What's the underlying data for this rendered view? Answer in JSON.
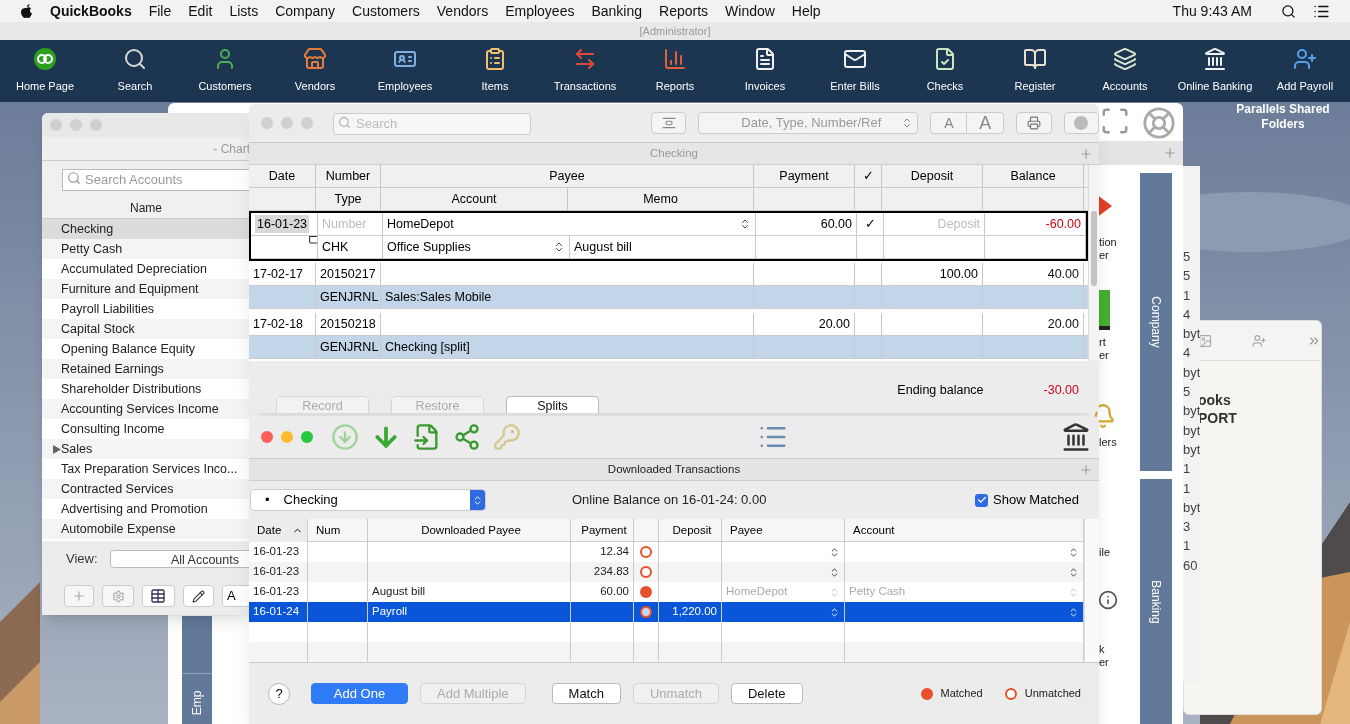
{
  "menu_bar": {
    "app": "QuickBooks",
    "items": [
      "File",
      "Edit",
      "Lists",
      "Company",
      "Customers",
      "Vendors",
      "Employees",
      "Banking",
      "Reports",
      "Window",
      "Help"
    ],
    "clock": "Thu 9:43 AM"
  },
  "title_strip": "[Administrator]",
  "toolbar": [
    {
      "label": "Home Page"
    },
    {
      "label": "Search"
    },
    {
      "label": "Customers"
    },
    {
      "label": "Vendors"
    },
    {
      "label": "Employees"
    },
    {
      "label": "Items"
    },
    {
      "label": "Transactions"
    },
    {
      "label": "Reports"
    },
    {
      "label": "Invoices"
    },
    {
      "label": "Enter Bills"
    },
    {
      "label": "Checks"
    },
    {
      "label": "Register"
    },
    {
      "label": "Accounts"
    },
    {
      "label": "Online Banking"
    },
    {
      "label": "Add Payroll"
    }
  ],
  "desktop": {
    "folder_label": "Parallels Shared Folders"
  },
  "home_page": {
    "side_tabs": [
      "Company",
      "Banking"
    ],
    "left_tab": "Emp",
    "icon_labels": [
      {
        "lines": [
          "tion",
          "er"
        ]
      },
      {
        "lines": [
          "rt",
          "er"
        ]
      },
      {
        "lines": [
          "lers"
        ]
      },
      {
        "lines": [
          "ile"
        ]
      },
      {
        "lines": [
          "k",
          "er"
        ]
      }
    ]
  },
  "side_list": {
    "entries": [
      "5",
      "5",
      "1",
      "4",
      "byt",
      "4",
      "byt",
      "5",
      "byt",
      "byt",
      "byt",
      "1",
      "1",
      "byt",
      "3",
      "1",
      "60"
    ]
  },
  "notes": {
    "lines": [
      "ooks",
      "PORT"
    ]
  },
  "chart_of_accounts": {
    "title": "- Chart",
    "search_placeholder": "Search Accounts",
    "column": "Name",
    "accounts": [
      {
        "name": "Checking",
        "selected": true,
        "expandable": false
      },
      {
        "name": "Petty Cash",
        "selected": false,
        "expandable": false
      },
      {
        "name": "Accumulated Depreciation",
        "selected": false,
        "expandable": false
      },
      {
        "name": "Furniture and Equipment",
        "selected": false,
        "expandable": false
      },
      {
        "name": "Payroll Liabilities",
        "selected": false,
        "expandable": false
      },
      {
        "name": "Capital Stock",
        "selected": false,
        "expandable": false
      },
      {
        "name": "Opening Balance Equity",
        "selected": false,
        "expandable": false
      },
      {
        "name": "Retained Earnings",
        "selected": false,
        "expandable": false
      },
      {
        "name": "Shareholder Distributions",
        "selected": false,
        "expandable": false
      },
      {
        "name": "Accounting Services Income",
        "selected": false,
        "expandable": false
      },
      {
        "name": "Consulting Income",
        "selected": false,
        "expandable": false
      },
      {
        "name": "Sales",
        "selected": false,
        "expandable": true
      },
      {
        "name": "Tax Preparation Services Inco...",
        "selected": false,
        "expandable": false
      },
      {
        "name": "Contracted Services",
        "selected": false,
        "expandable": false
      },
      {
        "name": "Advertising and Promotion",
        "selected": false,
        "expandable": false
      },
      {
        "name": "Automobile Expense",
        "selected": false,
        "expandable": false
      }
    ],
    "view_label": "View:",
    "view_value": "All Accounts",
    "cut_button": "A"
  },
  "register": {
    "search_placeholder": "Search",
    "sort_value": "Date, Type, Number/Ref",
    "font_buttons": [
      "A",
      "A"
    ],
    "title": "Checking",
    "header_top": [
      "Date",
      "Number",
      "Payee",
      "Payment",
      "✓",
      "Deposit",
      "Balance"
    ],
    "header_bottom": [
      "Type",
      "Account",
      "Memo"
    ],
    "transactions": [
      {
        "editing": true,
        "date": "16-01-23",
        "number_placeholder": "Number",
        "payee": "HomeDepot",
        "payment": "60.00",
        "cleared": "✓",
        "deposit_placeholder": "Deposit",
        "balance": "-60.00",
        "negative": true,
        "type": "CHK",
        "account": "Office Supplies",
        "memo": "August bill"
      },
      {
        "editing": false,
        "date": "17-02-17",
        "number": "20150217",
        "deposit": "100.00",
        "balance": "40.00",
        "negative": false,
        "type": "GENJRNL",
        "account": "Sales:Sales Mobile"
      },
      {
        "editing": false,
        "date": "17-02-18",
        "number": "20150218",
        "payment": "20.00",
        "balance": "20.00",
        "negative": false,
        "type": "GENJRNL",
        "account": "Checking [split]"
      }
    ],
    "ending_label": "Ending balance",
    "ending_value": "-30.00",
    "ending_negative": true,
    "buttons": [
      {
        "label": "Record",
        "disabled": true
      },
      {
        "label": "Restore",
        "disabled": true
      },
      {
        "label": "Splits",
        "disabled": false
      }
    ]
  },
  "downloaded": {
    "title": "Downloaded Transactions",
    "account_bullet": "•",
    "account": "Checking",
    "online_balance": "Online Balance on 16-01-24: 0.00",
    "show_matched": {
      "label": "Show Matched",
      "checked": true
    },
    "columns": [
      {
        "label": "Date",
        "sorted": true
      },
      {
        "label": "Num",
        "sorted": false
      },
      {
        "label": "Downloaded Payee",
        "sorted": false
      },
      {
        "label": "Payment",
        "sorted": false
      },
      {
        "sorted": false
      },
      {
        "label": "Deposit",
        "sorted": false
      },
      {
        "label": "Payee",
        "sorted": false
      },
      {
        "label": "Account",
        "sorted": false
      }
    ],
    "rows": [
      {
        "date": "16-01-23",
        "payment": "12.34",
        "matched": false,
        "selected": false
      },
      {
        "date": "16-01-23",
        "payment": "234.83",
        "matched": false,
        "selected": false
      },
      {
        "date": "16-01-23",
        "downloaded_payee": "August bill",
        "payment": "60.00",
        "matched": true,
        "payee": "HomeDepot",
        "account": "Petty Cash",
        "selected": false
      },
      {
        "date": "16-01-24",
        "downloaded_payee": "Payroll",
        "deposit": "1,220.00",
        "matched": false,
        "selected": true
      }
    ],
    "help": "?",
    "buttons": [
      {
        "label": "Add One",
        "kind": "primary",
        "disabled": false
      },
      {
        "label": "Add Multiple",
        "kind": "normal",
        "disabled": true
      },
      {
        "label": "Match",
        "kind": "normal",
        "disabled": false
      },
      {
        "label": "Unmatch",
        "kind": "normal",
        "disabled": true
      },
      {
        "label": "Delete",
        "kind": "normal",
        "disabled": false
      }
    ],
    "legend": [
      {
        "label": "Matched",
        "matched": true
      },
      {
        "label": "Unmatched",
        "matched": false
      }
    ]
  }
}
